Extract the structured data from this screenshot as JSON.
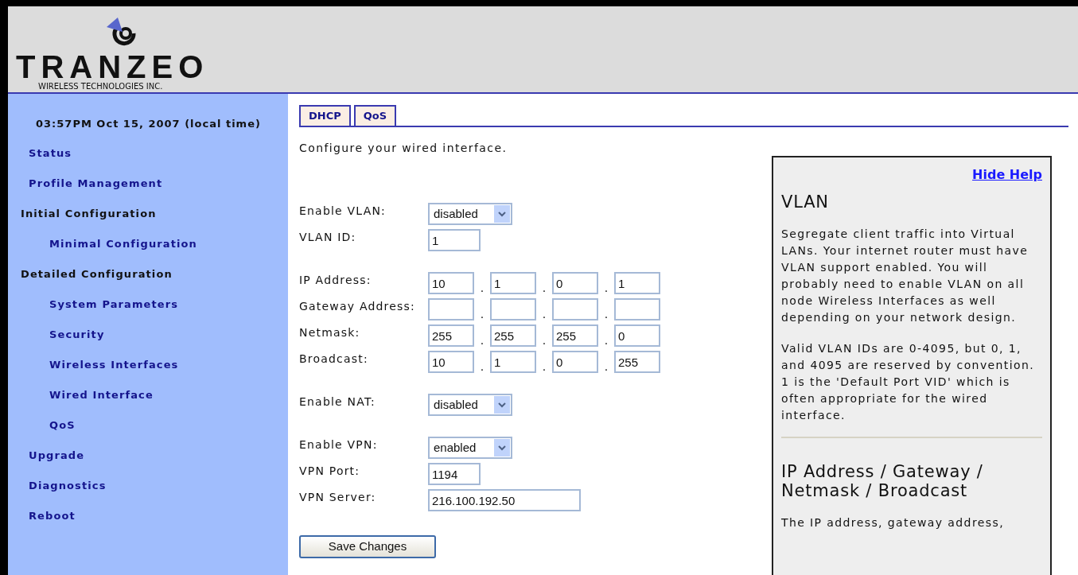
{
  "logo": {
    "name": "TRANZEO",
    "tagline": "WIRELESS TECHNOLOGIES INC."
  },
  "sidebar": {
    "clock": "03:57PM Oct 15, 2007 (local time)",
    "items": [
      {
        "kind": "link",
        "label": "Status"
      },
      {
        "kind": "link",
        "label": "Profile Management"
      },
      {
        "kind": "heading",
        "label": "Initial Configuration",
        "children": [
          {
            "label": "Minimal Configuration"
          }
        ]
      },
      {
        "kind": "heading",
        "label": "Detailed Configuration",
        "children": [
          {
            "label": "System Parameters"
          },
          {
            "label": "Security"
          },
          {
            "label": "Wireless Interfaces"
          },
          {
            "label": "Wired Interface"
          },
          {
            "label": "QoS"
          }
        ]
      },
      {
        "kind": "link",
        "label": "Upgrade"
      },
      {
        "kind": "link",
        "label": "Diagnostics"
      },
      {
        "kind": "link",
        "label": "Reboot"
      }
    ]
  },
  "tabs": [
    {
      "label": "DHCP"
    },
    {
      "label": "QoS"
    }
  ],
  "intro": "Configure your wired interface.",
  "form_groups": [
    [
      {
        "kind": "select",
        "label": "Enable VLAN:",
        "value": "disabled"
      },
      {
        "kind": "text",
        "label": "VLAN ID:",
        "value": "1"
      }
    ],
    [
      {
        "kind": "ip",
        "label": "IP Address:",
        "octets": [
          "10",
          "1",
          "0",
          "1"
        ],
        "separator": "."
      },
      {
        "kind": "ip",
        "label": "Gateway Address:",
        "separator": "."
      },
      {
        "kind": "ip",
        "label": "Netmask:",
        "octets": [
          "255",
          "255",
          "255",
          "0"
        ],
        "separator": "."
      },
      {
        "kind": "ip",
        "label": "Broadcast:",
        "octets": [
          "10",
          "1",
          "0",
          "255"
        ],
        "separator": "."
      }
    ],
    [
      {
        "kind": "select",
        "label": "Enable NAT:",
        "value": "disabled"
      }
    ],
    [
      {
        "kind": "select",
        "label": "Enable VPN:",
        "value": "enabled"
      },
      {
        "kind": "text",
        "label": "VPN Port:",
        "value": "1194"
      },
      {
        "kind": "wide",
        "label": "VPN Server:",
        "value": "216.100.192.50"
      }
    ]
  ],
  "save_button": "Save Changes",
  "help": {
    "hide_link": "Hide Help",
    "sections": [
      {
        "title": "VLAN",
        "paragraphs": [
          "Segregate client traffic into Virtual LANs. Your internet router must have VLAN support enabled. You will probably need to enable VLAN on all node Wireless Interfaces as well depending on your network design.",
          "Valid VLAN IDs are 0-4095, but 0, 1, and 4095 are reserved by convention. 1 is the 'Default Port VID' which is often appropriate for the wired interface."
        ]
      },
      {
        "title": "IP Address / Gateway / Netmask / Broadcast",
        "paragraphs": [
          "The IP address, gateway address,"
        ]
      }
    ]
  }
}
